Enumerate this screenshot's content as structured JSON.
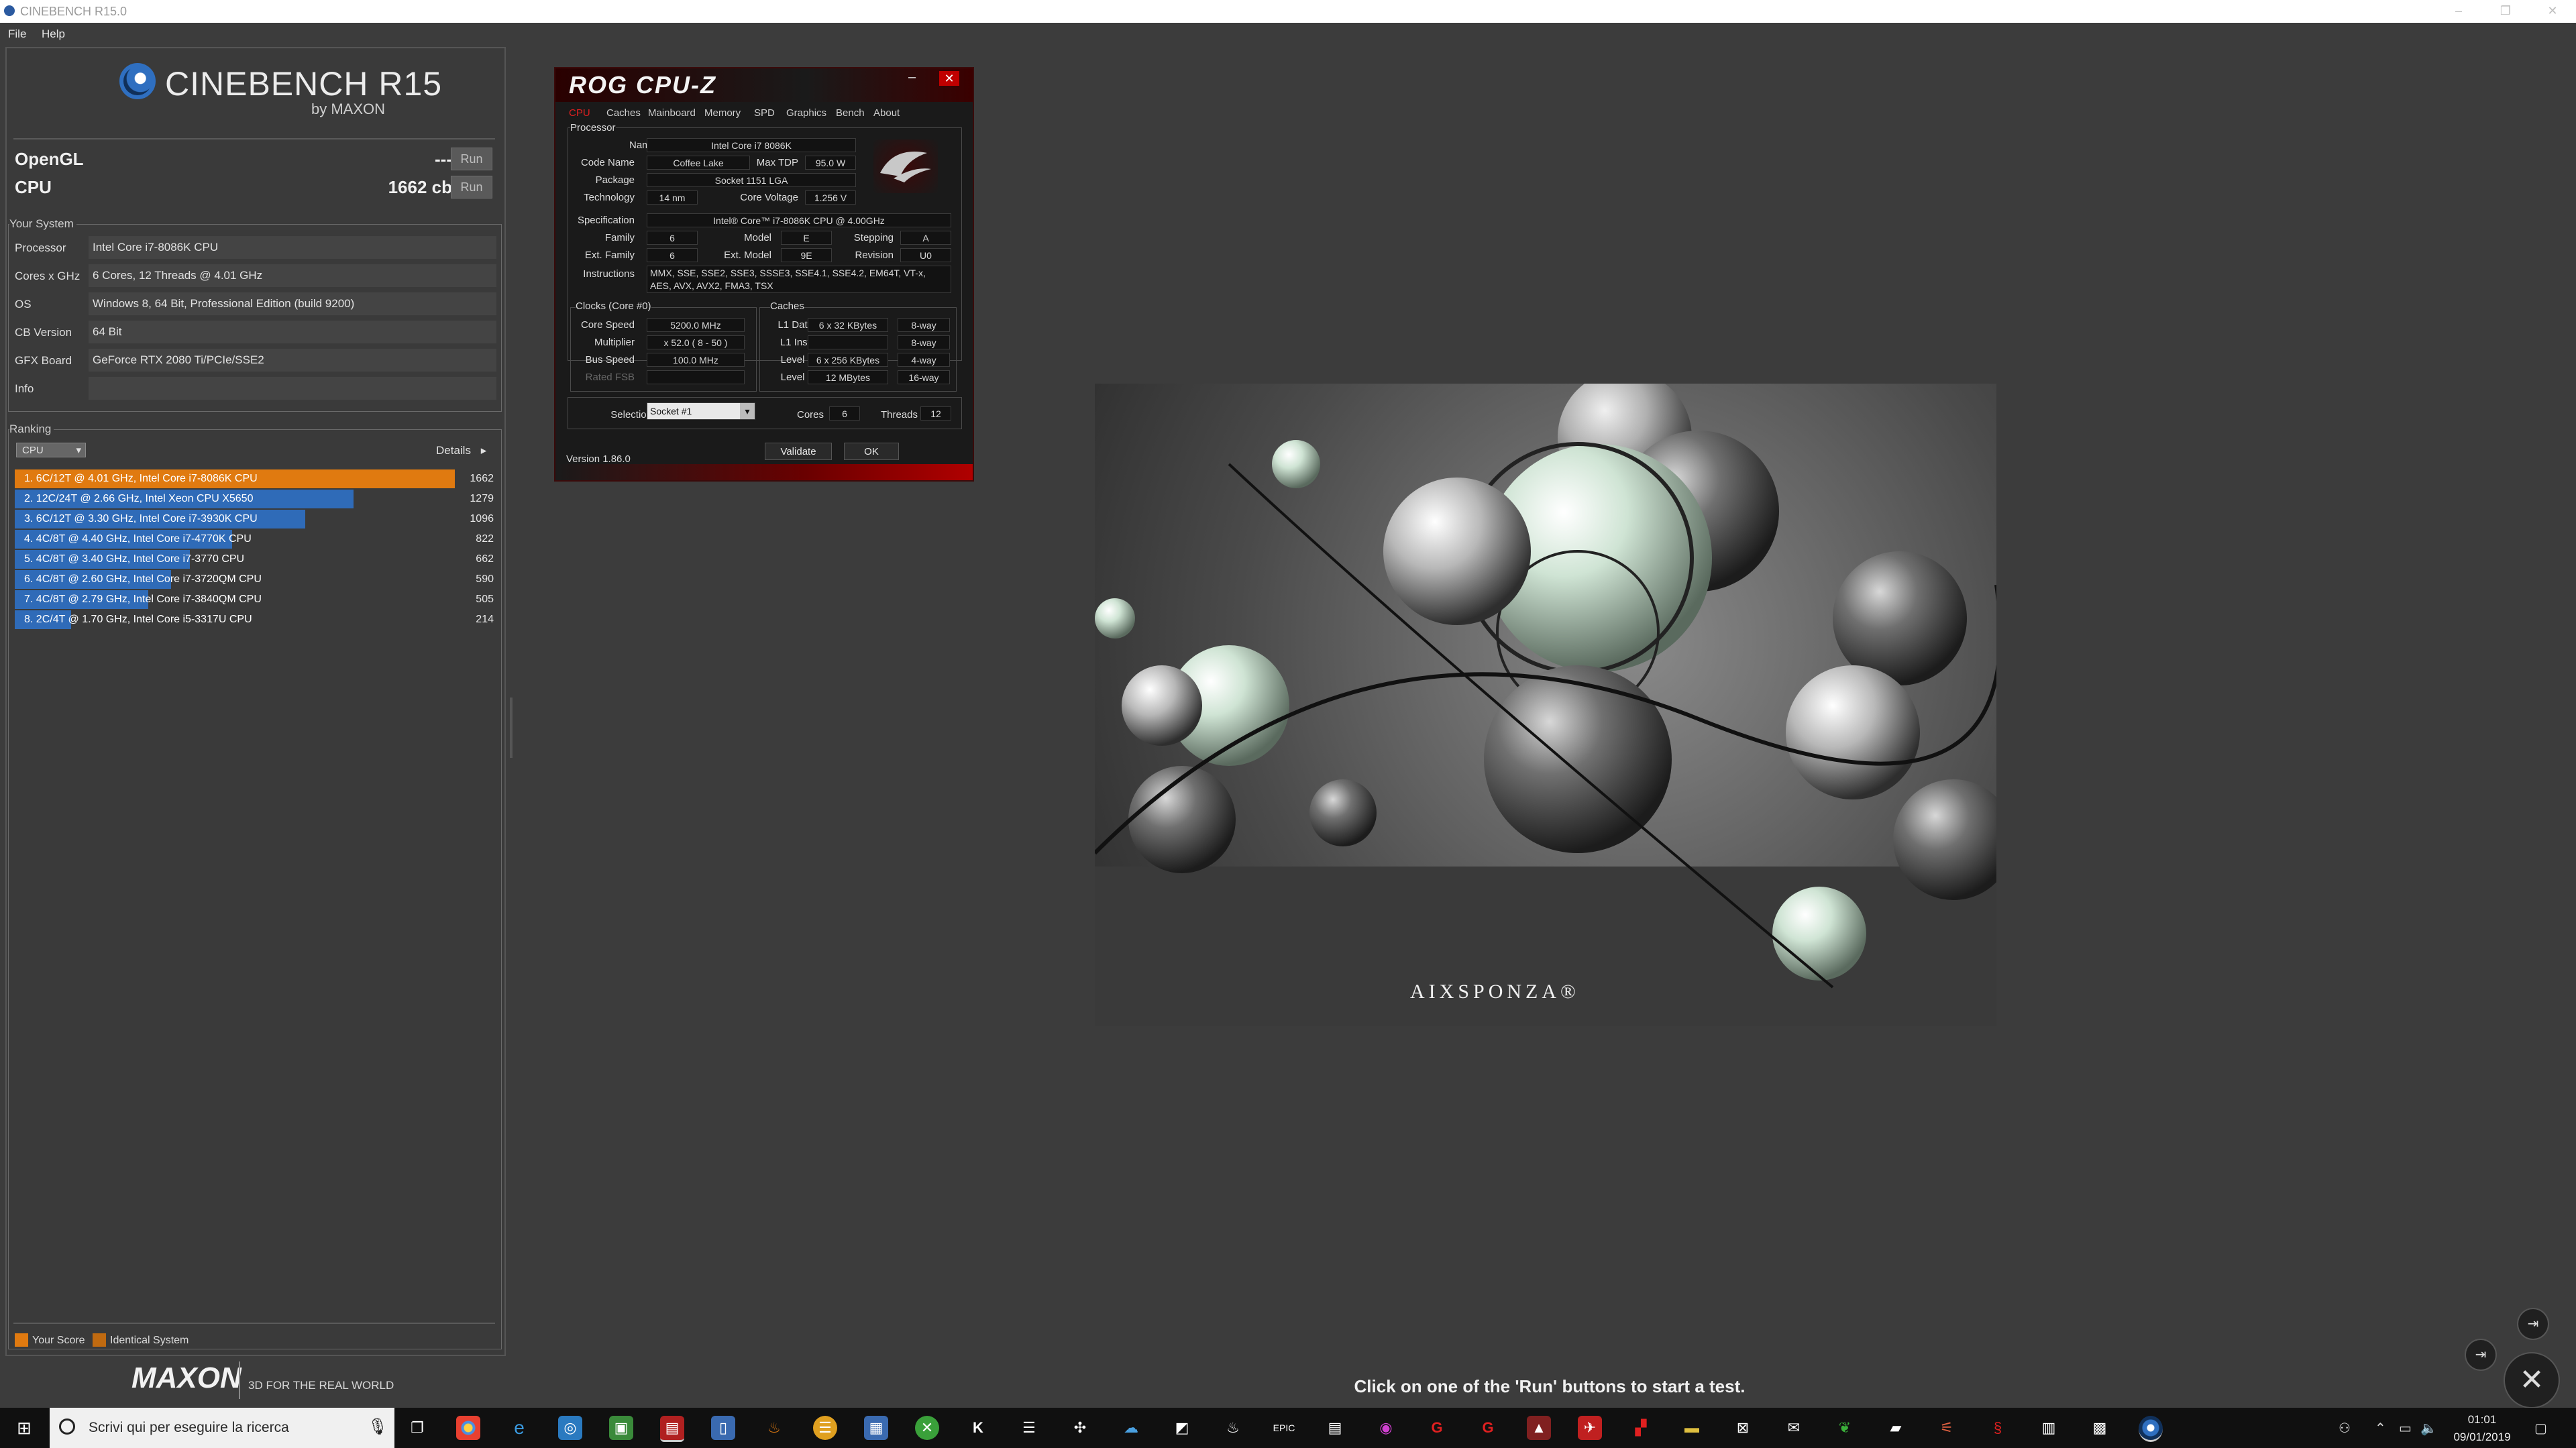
{
  "window": {
    "title": "CINEBENCH R15.0",
    "min_icon": "–",
    "max_icon": "❐",
    "close_icon": "✕"
  },
  "menu": {
    "file": "File",
    "help": "Help"
  },
  "logo": {
    "name": "CINEBENCH R15",
    "by": "by MAXON"
  },
  "scores": {
    "opengl": {
      "label": "OpenGL",
      "value": "---",
      "run": "Run"
    },
    "cpu": {
      "label": "CPU",
      "value": "1662 cb",
      "run": "Run"
    }
  },
  "your_system": {
    "title": "Your System",
    "rows": [
      {
        "key": "Processor",
        "value": "Intel Core i7-8086K CPU"
      },
      {
        "key": "Cores x GHz",
        "value": "6 Cores, 12 Threads @ 4.01 GHz"
      },
      {
        "key": "OS",
        "value": "Windows 8, 64 Bit, Professional Edition (build 9200)"
      },
      {
        "key": "CB Version",
        "value": "64 Bit"
      },
      {
        "key": "GFX Board",
        "value": "GeForce RTX 2080 Ti/PCIe/SSE2"
      },
      {
        "key": "Info",
        "value": ""
      }
    ]
  },
  "ranking": {
    "title": "Ranking",
    "selector": "CPU",
    "details": "Details",
    "details_arrow": "▸",
    "max": 1662,
    "rows": [
      {
        "label": "1. 6C/12T @ 4.01 GHz, Intel Core i7-8086K CPU",
        "score": 1662,
        "color": "#e07a10"
      },
      {
        "label": "2. 12C/24T @ 2.66 GHz, Intel Xeon CPU X5650",
        "score": 1279,
        "color": "#2f6bb8"
      },
      {
        "label": "3. 6C/12T @ 3.30 GHz,  Intel Core i7-3930K CPU",
        "score": 1096,
        "color": "#2f6bb8"
      },
      {
        "label": "4. 4C/8T @ 4.40 GHz, Intel Core i7-4770K CPU",
        "score": 822,
        "color": "#2f6bb8"
      },
      {
        "label": "5. 4C/8T @ 3.40 GHz,  Intel Core i7-3770 CPU",
        "score": 662,
        "color": "#2f6bb8"
      },
      {
        "label": "6. 4C/8T @ 2.60 GHz, Intel Core i7-3720QM CPU",
        "score": 590,
        "color": "#2f6bb8"
      },
      {
        "label": "7. 4C/8T @ 2.79 GHz,  Intel Core i7-3840QM CPU",
        "score": 505,
        "color": "#2f6bb8"
      },
      {
        "label": "8. 2C/4T @ 1.70 GHz,  Intel Core i5-3317U CPU",
        "score": 214,
        "color": "#2f6bb8"
      }
    ],
    "legend": {
      "your_score": "Your Score",
      "identical": "Identical System",
      "your_color": "#e07a10",
      "identical_color": "#c06a10"
    }
  },
  "maxon": {
    "logo": "MAXON",
    "tagline": "3D FOR THE REAL WORLD"
  },
  "status_message": "Click on one of the 'Run' buttons to start a test.",
  "cpuz": {
    "title": "ROG CPU-Z",
    "min_icon": "–",
    "close_icon": "✕",
    "tabs": [
      "CPU",
      "Caches",
      "Mainboard",
      "Memory",
      "SPD",
      "Graphics",
      "Bench",
      "About"
    ],
    "processor_title": "Processor",
    "name_label": "Name",
    "name": "Intel Core i7 8086K",
    "codename_label": "Code Name",
    "codename": "Coffee Lake",
    "maxtdp_label": "Max TDP",
    "maxtdp": "95.0 W",
    "package_label": "Package",
    "package": "Socket 1151 LGA",
    "technology_label": "Technology",
    "technology": "14 nm",
    "corevoltage_label": "Core Voltage",
    "corevoltage": "1.256 V",
    "spec_label": "Specification",
    "spec": "Intel® Core™ i7-8086K CPU @ 4.00GHz",
    "family_label": "Family",
    "family": "6",
    "model_label": "Model",
    "model": "E",
    "stepping_label": "Stepping",
    "stepping": "A",
    "extfamily_label": "Ext. Family",
    "extfamily": "6",
    "extmodel_label": "Ext. Model",
    "extmodel": "9E",
    "revision_label": "Revision",
    "revision": "U0",
    "instructions_label": "Instructions",
    "instructions": "MMX, SSE, SSE2, SSE3, SSSE3, SSE4.1, SSE4.2, EM64T, VT-x,",
    "instructions2": "AES, AVX, AVX2, FMA3, TSX",
    "clocks_title": "Clocks (Core #0)",
    "corespeed_label": "Core Speed",
    "corespeed": "5200.0 MHz",
    "multiplier_label": "Multiplier",
    "multiplier": "x 52.0 ( 8 - 50 )",
    "busspeed_label": "Bus Speed",
    "busspeed": "100.0 MHz",
    "ratedfsb_label": "Rated FSB",
    "ratedfsb": "",
    "caches_title": "Caches",
    "l1d_label": "L1 Data",
    "l1d": "6 x 32 KBytes",
    "l1d_way": "8-way",
    "l1i_label": "L1 Inst.",
    "l1i": "",
    "l1i_way": "8-way",
    "l2_label": "Level 2",
    "l2": "6 x 256 KBytes",
    "l2_way": "4-way",
    "l3_label": "Level 3",
    "l3": "12 MBytes",
    "l3_way": "16-way",
    "selection_label": "Selection",
    "selection": "Socket #1",
    "cores_label": "Cores",
    "cores": "6",
    "threads_label": "Threads",
    "threads": "12",
    "version": "Version 1.86.0",
    "validate": "Validate",
    "ok": "OK"
  },
  "render": {
    "watermark": "AIXSPONZA®"
  },
  "taskbar": {
    "search_placeholder": "Scrivi qui per eseguire la ricerca",
    "time": "01:01",
    "date": "09/01/2019"
  }
}
